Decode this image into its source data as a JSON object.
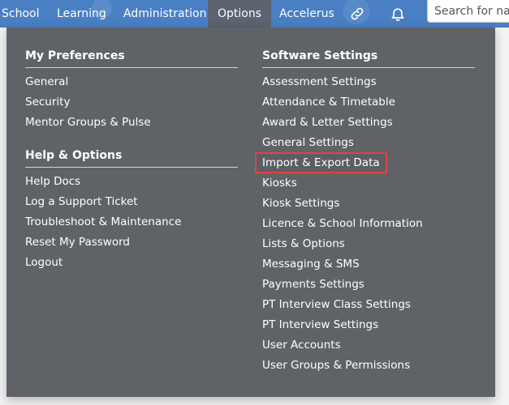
{
  "nav": {
    "items": [
      "School",
      "Learning",
      "Administration",
      "Options",
      "Accelerus"
    ],
    "active": "Options",
    "search_placeholder": "Search for nar"
  },
  "icons": {
    "link": "link-icon",
    "notifications": "bell-icon"
  },
  "colors": {
    "topbar": "#4a7fc4",
    "dropdown_bg": "#5f6368",
    "highlight_border": "#e84040"
  },
  "menu": {
    "my_preferences": {
      "heading": "My Preferences",
      "items": [
        "General",
        "Security",
        "Mentor Groups & Pulse"
      ]
    },
    "help_options": {
      "heading": "Help & Options",
      "items": [
        "Help Docs",
        "Log a Support Ticket",
        "Troubleshoot & Maintenance",
        "Reset My Password",
        "Logout"
      ]
    },
    "software_settings": {
      "heading": "Software Settings",
      "items": [
        "Assessment Settings",
        "Attendance & Timetable",
        "Award & Letter Settings",
        "General Settings",
        "Import & Export Data",
        "Kiosks",
        "Kiosk Settings",
        "Licence & School Information",
        "Lists & Options",
        "Messaging & SMS",
        "Payments Settings",
        "PT Interview Class Settings",
        "PT Interview Settings",
        "User Accounts",
        "User Groups & Permissions"
      ],
      "highlighted": "Import & Export Data"
    }
  }
}
